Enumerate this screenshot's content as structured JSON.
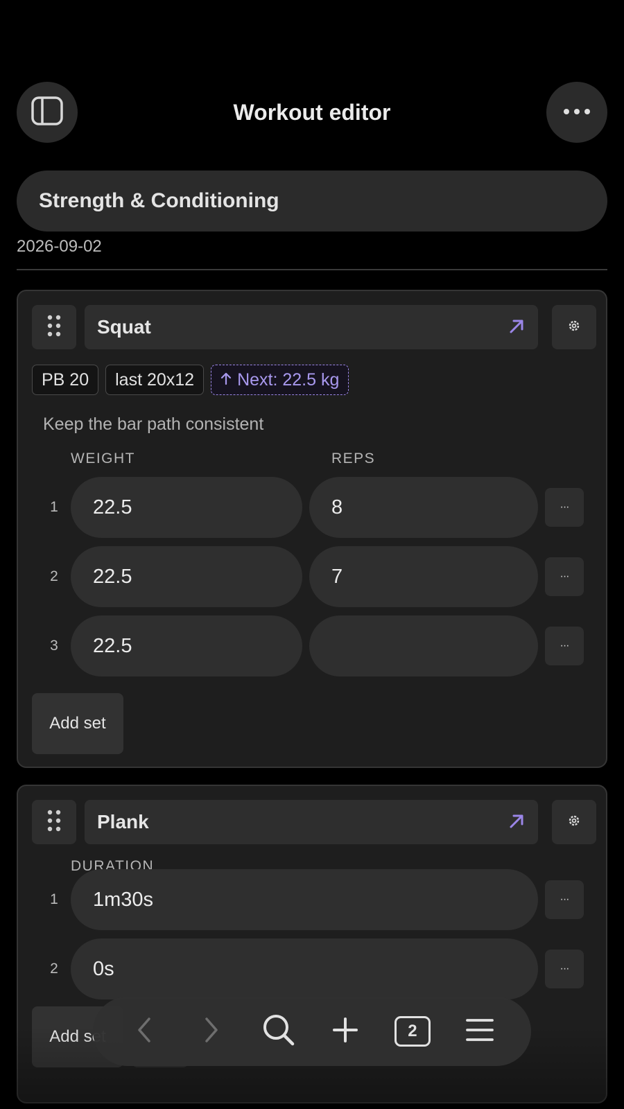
{
  "header": {
    "title": "Workout editor",
    "left_icon": "sidebar-icon",
    "right_icon": "more-horizontal-icon"
  },
  "workout": {
    "name": "Strength & Conditioning",
    "date": "2026-09-02"
  },
  "exercises": [
    {
      "name": "Squat",
      "chips": [
        "PB 20",
        "last 20x12"
      ],
      "next_chip": "Next: 22.5 kg",
      "note": "Keep the bar path consistent",
      "columns": [
        "WEIGHT",
        "REPS"
      ],
      "sets": [
        {
          "num": "1",
          "weight": "22.5",
          "reps": "8",
          "more": "···"
        },
        {
          "num": "2",
          "weight": "22.5",
          "reps": "7",
          "more": "···"
        },
        {
          "num": "3",
          "weight": "22.5",
          "reps": "",
          "more": "···"
        }
      ],
      "add_label": "Add set"
    },
    {
      "name": "Plank",
      "columns": [
        "DURATION"
      ],
      "sets": [
        {
          "num": "1",
          "duration": "1m30s",
          "more": "···"
        },
        {
          "num": "2",
          "duration": "0s",
          "more": "···"
        }
      ],
      "add_label": "Add set"
    }
  ],
  "toolbar": {
    "tabs_count": "2",
    "icons": [
      "back-icon",
      "forward-icon",
      "search-icon",
      "plus-icon",
      "tabs-icon",
      "menu-icon"
    ]
  },
  "colors": {
    "background": "#000000",
    "surface": "#2b2b2b",
    "card": "#1e1e1e",
    "accent": "#9b86e8"
  }
}
